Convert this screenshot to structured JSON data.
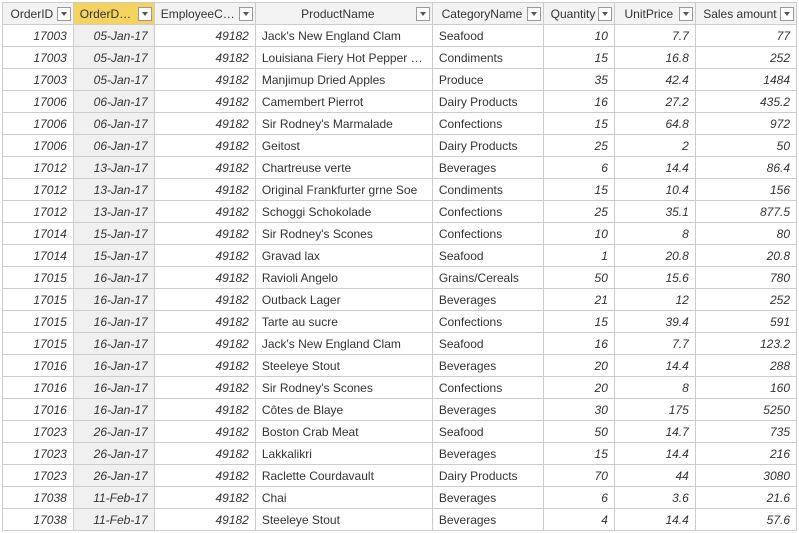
{
  "columns": [
    {
      "key": "OrderID",
      "label": "OrderID",
      "type": "num",
      "selected": false
    },
    {
      "key": "OrderDate",
      "label": "OrderDate",
      "type": "date",
      "selected": true
    },
    {
      "key": "EmployeeCode",
      "label": "EmployeeCode",
      "type": "num",
      "selected": false
    },
    {
      "key": "ProductName",
      "label": "ProductName",
      "type": "text",
      "selected": false
    },
    {
      "key": "CategoryName",
      "label": "CategoryName",
      "type": "text",
      "selected": false
    },
    {
      "key": "Quantity",
      "label": "Quantity",
      "type": "num",
      "selected": false
    },
    {
      "key": "UnitPrice",
      "label": "UnitPrice",
      "type": "num",
      "selected": false
    },
    {
      "key": "SalesAmount",
      "label": "Sales amount",
      "type": "num",
      "selected": false
    }
  ],
  "rows": [
    {
      "OrderID": "17003",
      "OrderDate": "05-Jan-17",
      "EmployeeCode": "49182",
      "ProductName": "Jack's New England Clam",
      "CategoryName": "Seafood",
      "Quantity": "10",
      "UnitPrice": "7.7",
      "SalesAmount": "77"
    },
    {
      "OrderID": "17003",
      "OrderDate": "05-Jan-17",
      "EmployeeCode": "49182",
      "ProductName": "Louisiana Fiery Hot Pepper Sauce",
      "CategoryName": "Condiments",
      "Quantity": "15",
      "UnitPrice": "16.8",
      "SalesAmount": "252"
    },
    {
      "OrderID": "17003",
      "OrderDate": "05-Jan-17",
      "EmployeeCode": "49182",
      "ProductName": "Manjimup Dried Apples",
      "CategoryName": "Produce",
      "Quantity": "35",
      "UnitPrice": "42.4",
      "SalesAmount": "1484"
    },
    {
      "OrderID": "17006",
      "OrderDate": "06-Jan-17",
      "EmployeeCode": "49182",
      "ProductName": "Camembert Pierrot",
      "CategoryName": "Dairy Products",
      "Quantity": "16",
      "UnitPrice": "27.2",
      "SalesAmount": "435.2"
    },
    {
      "OrderID": "17006",
      "OrderDate": "06-Jan-17",
      "EmployeeCode": "49182",
      "ProductName": "Sir Rodney's Marmalade",
      "CategoryName": "Confections",
      "Quantity": "15",
      "UnitPrice": "64.8",
      "SalesAmount": "972"
    },
    {
      "OrderID": "17006",
      "OrderDate": "06-Jan-17",
      "EmployeeCode": "49182",
      "ProductName": "Geitost",
      "CategoryName": "Dairy Products",
      "Quantity": "25",
      "UnitPrice": "2",
      "SalesAmount": "50"
    },
    {
      "OrderID": "17012",
      "OrderDate": "13-Jan-17",
      "EmployeeCode": "49182",
      "ProductName": "Chartreuse verte",
      "CategoryName": "Beverages",
      "Quantity": "6",
      "UnitPrice": "14.4",
      "SalesAmount": "86.4"
    },
    {
      "OrderID": "17012",
      "OrderDate": "13-Jan-17",
      "EmployeeCode": "49182",
      "ProductName": "Original Frankfurter grne Soe",
      "CategoryName": "Condiments",
      "Quantity": "15",
      "UnitPrice": "10.4",
      "SalesAmount": "156"
    },
    {
      "OrderID": "17012",
      "OrderDate": "13-Jan-17",
      "EmployeeCode": "49182",
      "ProductName": "Schoggi Schokolade",
      "CategoryName": "Confections",
      "Quantity": "25",
      "UnitPrice": "35.1",
      "SalesAmount": "877.5"
    },
    {
      "OrderID": "17014",
      "OrderDate": "15-Jan-17",
      "EmployeeCode": "49182",
      "ProductName": "Sir Rodney's Scones",
      "CategoryName": "Confections",
      "Quantity": "10",
      "UnitPrice": "8",
      "SalesAmount": "80"
    },
    {
      "OrderID": "17014",
      "OrderDate": "15-Jan-17",
      "EmployeeCode": "49182",
      "ProductName": "Gravad lax",
      "CategoryName": "Seafood",
      "Quantity": "1",
      "UnitPrice": "20.8",
      "SalesAmount": "20.8"
    },
    {
      "OrderID": "17015",
      "OrderDate": "16-Jan-17",
      "EmployeeCode": "49182",
      "ProductName": "Ravioli Angelo",
      "CategoryName": "Grains/Cereals",
      "Quantity": "50",
      "UnitPrice": "15.6",
      "SalesAmount": "780"
    },
    {
      "OrderID": "17015",
      "OrderDate": "16-Jan-17",
      "EmployeeCode": "49182",
      "ProductName": "Outback Lager",
      "CategoryName": "Beverages",
      "Quantity": "21",
      "UnitPrice": "12",
      "SalesAmount": "252"
    },
    {
      "OrderID": "17015",
      "OrderDate": "16-Jan-17",
      "EmployeeCode": "49182",
      "ProductName": "Tarte au sucre",
      "CategoryName": "Confections",
      "Quantity": "15",
      "UnitPrice": "39.4",
      "SalesAmount": "591"
    },
    {
      "OrderID": "17015",
      "OrderDate": "16-Jan-17",
      "EmployeeCode": "49182",
      "ProductName": "Jack's New England Clam",
      "CategoryName": "Seafood",
      "Quantity": "16",
      "UnitPrice": "7.7",
      "SalesAmount": "123.2"
    },
    {
      "OrderID": "17016",
      "OrderDate": "16-Jan-17",
      "EmployeeCode": "49182",
      "ProductName": "Steeleye Stout",
      "CategoryName": "Beverages",
      "Quantity": "20",
      "UnitPrice": "14.4",
      "SalesAmount": "288"
    },
    {
      "OrderID": "17016",
      "OrderDate": "16-Jan-17",
      "EmployeeCode": "49182",
      "ProductName": "Sir Rodney's Scones",
      "CategoryName": "Confections",
      "Quantity": "20",
      "UnitPrice": "8",
      "SalesAmount": "160"
    },
    {
      "OrderID": "17016",
      "OrderDate": "16-Jan-17",
      "EmployeeCode": "49182",
      "ProductName": "Côtes de Blaye",
      "CategoryName": "Beverages",
      "Quantity": "30",
      "UnitPrice": "175",
      "SalesAmount": "5250"
    },
    {
      "OrderID": "17023",
      "OrderDate": "26-Jan-17",
      "EmployeeCode": "49182",
      "ProductName": "Boston Crab Meat",
      "CategoryName": "Seafood",
      "Quantity": "50",
      "UnitPrice": "14.7",
      "SalesAmount": "735"
    },
    {
      "OrderID": "17023",
      "OrderDate": "26-Jan-17",
      "EmployeeCode": "49182",
      "ProductName": "Lakkalikri",
      "CategoryName": "Beverages",
      "Quantity": "15",
      "UnitPrice": "14.4",
      "SalesAmount": "216"
    },
    {
      "OrderID": "17023",
      "OrderDate": "26-Jan-17",
      "EmployeeCode": "49182",
      "ProductName": "Raclette Courdavault",
      "CategoryName": "Dairy Products",
      "Quantity": "70",
      "UnitPrice": "44",
      "SalesAmount": "3080"
    },
    {
      "OrderID": "17038",
      "OrderDate": "11-Feb-17",
      "EmployeeCode": "49182",
      "ProductName": "Chai",
      "CategoryName": "Beverages",
      "Quantity": "6",
      "UnitPrice": "3.6",
      "SalesAmount": "21.6"
    },
    {
      "OrderID": "17038",
      "OrderDate": "11-Feb-17",
      "EmployeeCode": "49182",
      "ProductName": "Steeleye Stout",
      "CategoryName": "Beverages",
      "Quantity": "4",
      "UnitPrice": "14.4",
      "SalesAmount": "57.6"
    }
  ]
}
